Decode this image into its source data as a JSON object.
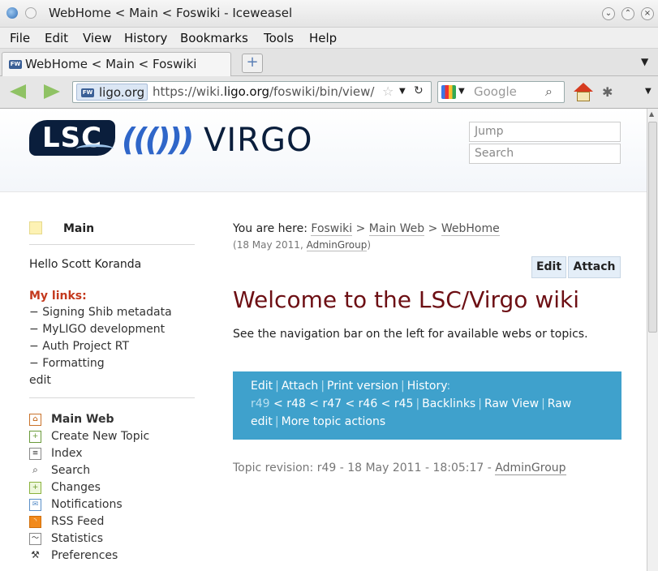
{
  "window": {
    "title": "WebHome < Main < Foswiki - Iceweasel"
  },
  "menu": [
    "File",
    "Edit",
    "View",
    "History",
    "Bookmarks",
    "Tools",
    "Help"
  ],
  "tab": {
    "label": "WebHome < Main < Foswiki",
    "favicon": "FW"
  },
  "nav": {
    "domain": "ligo.org",
    "url_prefix": "https://wiki.",
    "url_host": "ligo.org",
    "url_path": "/foswiki/bin/view/",
    "search_placeholder": "Google"
  },
  "header": {
    "logo_lsc": "LSC",
    "logo_waves": "((()))",
    "logo_virgo": "VIRGO",
    "jump_placeholder": "Jump",
    "search_placeholder": "Search"
  },
  "sidebar": {
    "web_name": "Main",
    "hello": "Hello Scott Koranda",
    "mylinks_title": "My links:",
    "mylinks": [
      "Signing Shib metadata",
      "MyLIGO development",
      "Auth Project RT",
      "Formatting"
    ],
    "edit_link": "edit",
    "items": [
      {
        "label": "Main Web",
        "icon": "home-icon"
      },
      {
        "label": "Create New Topic",
        "icon": "new-topic-icon"
      },
      {
        "label": "Index",
        "icon": "index-icon"
      },
      {
        "label": "Search",
        "icon": "search-icon"
      },
      {
        "label": "Changes",
        "icon": "changes-icon"
      },
      {
        "label": "Notifications",
        "icon": "notifications-icon"
      },
      {
        "label": "RSS Feed",
        "icon": "rss-icon"
      },
      {
        "label": "Statistics",
        "icon": "statistics-icon"
      },
      {
        "label": "Preferences",
        "icon": "preferences-icon"
      }
    ]
  },
  "main": {
    "breadcrumb_prefix": "You are here:",
    "breadcrumb": [
      "Foswiki",
      "Main Web",
      "WebHome"
    ],
    "date": "18 May 2011",
    "author": "AdminGroup",
    "edit_btn": "Edit",
    "attach_btn": "Attach",
    "heading": "Welcome to the LSC/Virgo wiki",
    "intro": "See the navigation bar on the left for available webs or topics.",
    "actions": {
      "edit": "Edit",
      "attach": "Attach",
      "print": "Print version",
      "history": "History",
      "revs": [
        "r49",
        "r48",
        "r47",
        "r46",
        "r45"
      ],
      "backlinks": "Backlinks",
      "raw_view": "Raw View",
      "raw_edit": "Raw edit",
      "more": "More topic actions"
    },
    "revision_text": "Topic revision: r49 - 18 May 2011 - 18:05:17 -",
    "revision_author": "AdminGroup"
  },
  "colors": {
    "heading": "#6d0f14",
    "action_bar": "#3fa1cc"
  }
}
